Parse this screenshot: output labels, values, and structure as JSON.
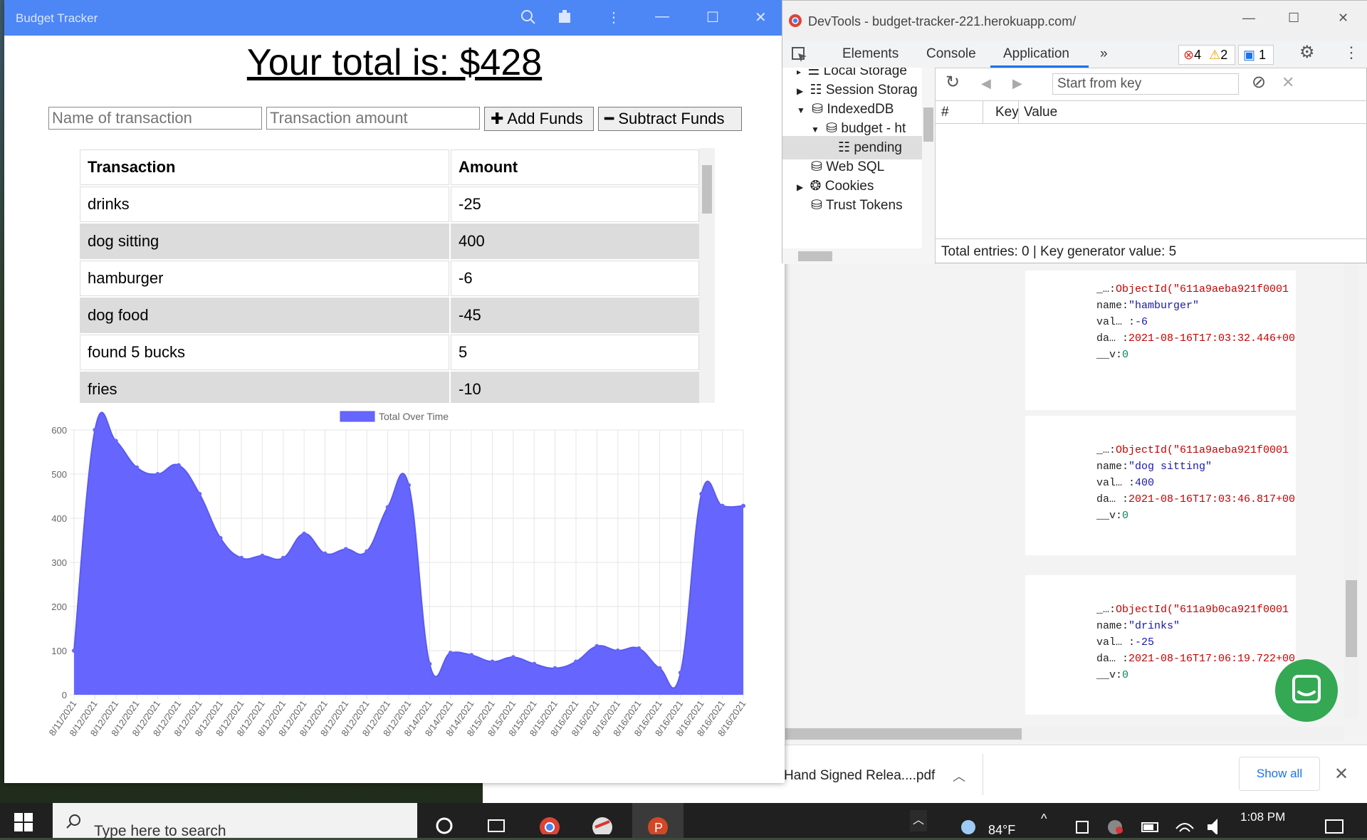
{
  "app": {
    "title": "Budget Tracker",
    "total_text": "Your total is: $428",
    "name_placeholder": "Name of transaction",
    "amount_placeholder": "Transaction amount",
    "add_label": "Add Funds",
    "subtract_label": "Subtract Funds",
    "table": {
      "headers": [
        "Transaction",
        "Amount"
      ],
      "rows": [
        {
          "name": "drinks",
          "amount": "-25"
        },
        {
          "name": "dog sitting",
          "amount": "400"
        },
        {
          "name": "hamburger",
          "amount": "-6"
        },
        {
          "name": "dog food",
          "amount": "-45"
        },
        {
          "name": "found 5 bucks",
          "amount": "5"
        },
        {
          "name": "fries",
          "amount": "-10"
        }
      ]
    }
  },
  "chart_data": {
    "type": "area",
    "legend": "Total Over Time",
    "legend_position": "top",
    "color": "#6666ff",
    "grid": true,
    "ylim": [
      0,
      600
    ],
    "yticks": [
      0,
      100,
      200,
      300,
      400,
      500,
      600
    ],
    "x": [
      "8/11/2021",
      "8/12/2021",
      "8/12/2021",
      "8/12/2021",
      "8/12/2021",
      "8/12/2021",
      "8/12/2021",
      "8/12/2021",
      "8/12/2021",
      "8/12/2021",
      "8/12/2021",
      "8/12/2021",
      "8/12/2021",
      "8/12/2021",
      "8/12/2021",
      "8/12/2021",
      "8/12/2021",
      "8/14/2021",
      "8/14/2021",
      "8/14/2021",
      "8/15/2021",
      "8/15/2021",
      "8/15/2021",
      "8/15/2021",
      "8/16/2021",
      "8/16/2021",
      "8/16/2021",
      "8/16/2021",
      "8/16/2021",
      "8/16/2021",
      "8/16/2021",
      "8/16/2021",
      "8/16/2021"
    ],
    "values": [
      100,
      600,
      575,
      515,
      500,
      520,
      455,
      355,
      310,
      315,
      310,
      365,
      320,
      330,
      325,
      425,
      475,
      70,
      95,
      90,
      75,
      85,
      70,
      60,
      75,
      110,
      100,
      105,
      60,
      50,
      455,
      428,
      428
    ]
  },
  "devtools": {
    "window_title": "DevTools - budget-tracker-221.herokuapp.com/",
    "tabs": [
      "Elements",
      "Console",
      "Application"
    ],
    "active_tab": "Application",
    "errors": "4",
    "warnings": "2",
    "messages": "1",
    "tree": [
      "Local Storage",
      "Session Storag",
      "IndexedDB",
      "budget - ht",
      "pending",
      "Web SQL",
      "Cookies",
      "Trust Tokens"
    ],
    "start_from_key": "Start from key",
    "columns": [
      "#",
      "Key",
      "Value"
    ],
    "footer": "Total entries: 0  |  Key generator value: 5"
  },
  "records": [
    {
      "id": "ObjectId(\"611a9aeba921f0001",
      "name": "\"hamburger\"",
      "value": "-6",
      "date": "2021-08-16T17:03:32.446+00",
      "v": "0"
    },
    {
      "id": "ObjectId(\"611a9aeba921f0001",
      "name": "\"dog sitting\"",
      "value": "400",
      "date": "2021-08-16T17:03:46.817+00",
      "v": "0"
    },
    {
      "id": "ObjectId(\"611a9b0ca921f0001",
      "name": "\"drinks\"",
      "value": "-25",
      "date": "2021-08-16T17:06:19.722+00",
      "v": "0"
    }
  ],
  "record_labels": {
    "id": "_…:",
    "name": "name:",
    "value": "val… :",
    "date": "da… :",
    "v": "__v:"
  },
  "download": {
    "file": "Hand Signed Relea....pdf",
    "show_all": "Show all"
  },
  "taskbar": {
    "search_placeholder": "Type here to search",
    "temperature": "84°F",
    "time": "1:08 PM"
  }
}
